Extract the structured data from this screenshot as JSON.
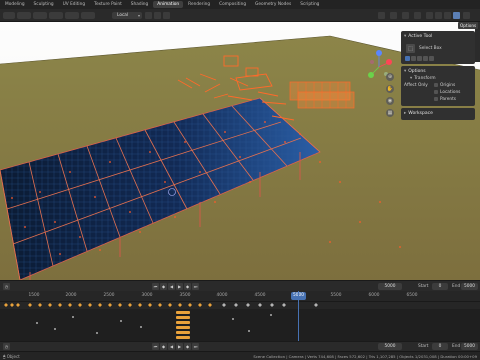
{
  "topbar": {
    "tabs": [
      {
        "label": "Modeling",
        "active": false
      },
      {
        "label": "Sculpting",
        "active": false
      },
      {
        "label": "UV Editing",
        "active": false
      },
      {
        "label": "Texture Paint",
        "active": false
      },
      {
        "label": "Shading",
        "active": false
      },
      {
        "label": "Animation",
        "active": true
      },
      {
        "label": "Rendering",
        "active": false
      },
      {
        "label": "Compositing",
        "active": false
      },
      {
        "label": "Geometry Nodes",
        "active": false
      },
      {
        "label": "Scripting",
        "active": false
      }
    ]
  },
  "viewport_header": {
    "orientation_label": "Local",
    "options_tab": "Options"
  },
  "npanel": {
    "active_tool": {
      "title": "Active Tool",
      "tool_name": "Select Box"
    },
    "options": {
      "title": "Options",
      "transform_title": "Transform",
      "affect_only_label": "Affect Only",
      "checkboxes": [
        "Origins",
        "Locations",
        "Parents"
      ]
    },
    "workspace": {
      "title": "Workspace"
    }
  },
  "playback": {
    "current_frame": "5000",
    "start_label": "Start",
    "start_value": "0",
    "end_label": "End",
    "end_value": "5000"
  },
  "timeline": {
    "ruler_labels": [
      "1500",
      "2000",
      "2500",
      "3000",
      "3500",
      "4000",
      "4500",
      "5000",
      "5500",
      "6000",
      "6500"
    ],
    "current_frame_label": "5000"
  },
  "playback_bottom": {
    "current_frame": "5000",
    "start_label": "Start",
    "start_value": "0",
    "end_label": "End",
    "end_value": "5000"
  },
  "statusbar": {
    "left_text": "Object",
    "right_text": "Scene Collection | Camera | Verts 744,608 | Faces 572,602 | Tris 1,107,285 | Objects 1/2031,008 | Duration 00:00+09"
  },
  "colors": {
    "accent": "#4772b3",
    "ground": "#8a7d45",
    "sky": "#ffffff",
    "panel_blue": "#1b3b6e",
    "wire_orange": "#ff6a2a"
  }
}
